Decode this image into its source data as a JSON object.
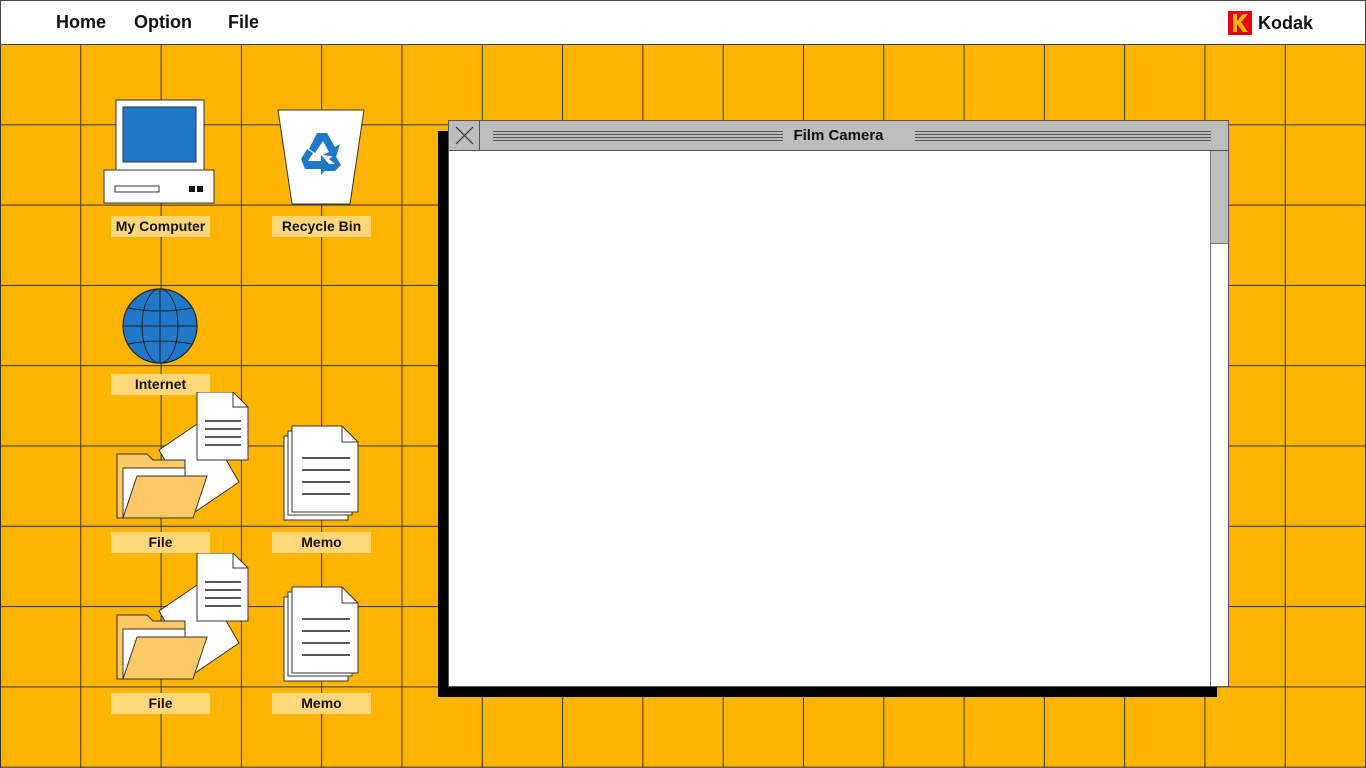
{
  "menubar": {
    "items": [
      {
        "label": "Home"
      },
      {
        "label": "Option"
      },
      {
        "label": "File"
      }
    ],
    "brand": {
      "name": "Kodak",
      "logo_color": "#E30613"
    }
  },
  "desktop": {
    "background_color": "#FFB400",
    "label_color": "#FFD67A",
    "icons": [
      {
        "label": "My Computer",
        "icon": "computer-icon"
      },
      {
        "label": "Recycle Bin",
        "icon": "recycle-bin-icon"
      },
      {
        "label": "Internet",
        "icon": "globe-icon"
      },
      {
        "label": "File",
        "icon": "folder-icon"
      },
      {
        "label": "Memo",
        "icon": "memo-icon"
      },
      {
        "label": "File",
        "icon": "folder-icon"
      },
      {
        "label": "Memo",
        "icon": "memo-icon"
      }
    ]
  },
  "window": {
    "title": "Film Camera",
    "close_icon": "close-icon",
    "titlebar_color": "#BDBDBD"
  }
}
